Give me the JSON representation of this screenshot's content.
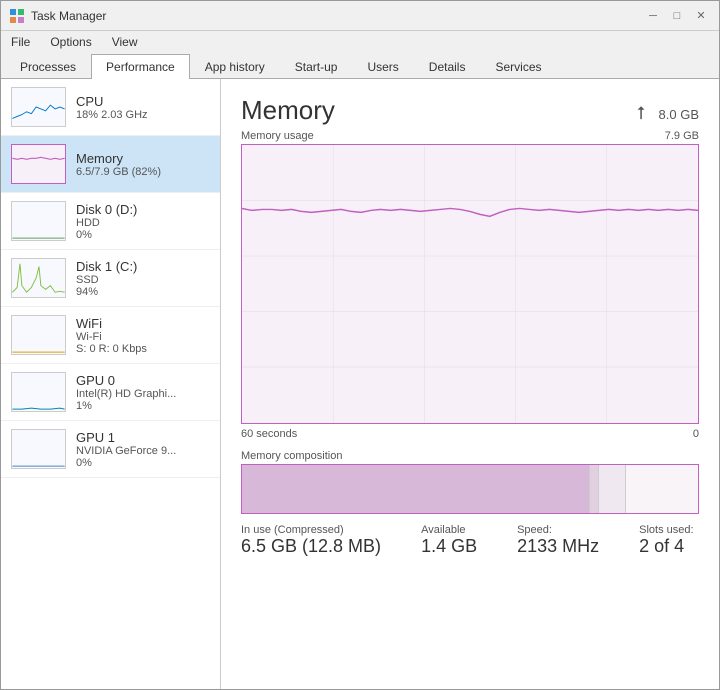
{
  "window": {
    "title": "Task Manager",
    "controls": [
      "─",
      "□",
      "✕"
    ]
  },
  "menu": {
    "items": [
      "File",
      "Options",
      "View"
    ]
  },
  "tabs": [
    {
      "label": "Processes",
      "active": false
    },
    {
      "label": "Performance",
      "active": true
    },
    {
      "label": "App history",
      "active": false
    },
    {
      "label": "Start-up",
      "active": false
    },
    {
      "label": "Users",
      "active": false
    },
    {
      "label": "Details",
      "active": false
    },
    {
      "label": "Services",
      "active": false
    }
  ],
  "sidebar": {
    "items": [
      {
        "id": "cpu",
        "title": "CPU",
        "subtitle": "18% 2.03 GHz",
        "value": "",
        "active": false,
        "color": "#0078d4"
      },
      {
        "id": "memory",
        "title": "Memory",
        "subtitle": "6.5/7.9 GB (82%)",
        "value": "",
        "active": true,
        "color": "#c060c0"
      },
      {
        "id": "disk0",
        "title": "Disk 0 (D:)",
        "subtitle": "HDD",
        "value": "0%",
        "active": false,
        "color": "#60a060"
      },
      {
        "id": "disk1",
        "title": "Disk 1 (C:)",
        "subtitle": "SSD",
        "value": "94%",
        "active": false,
        "color": "#80c040"
      },
      {
        "id": "wifi",
        "title": "WiFi",
        "subtitle": "Wi-Fi",
        "value": "S: 0  R: 0 Kbps",
        "active": false,
        "color": "#e0a000"
      },
      {
        "id": "gpu0",
        "title": "GPU 0",
        "subtitle": "Intel(R) HD Graphi...",
        "value": "1%",
        "active": false,
        "color": "#0088aa"
      },
      {
        "id": "gpu1",
        "title": "GPU 1",
        "subtitle": "NVIDIA GeForce 9...",
        "value": "0%",
        "active": false,
        "color": "#4488bb"
      }
    ]
  },
  "main": {
    "title": "Memory",
    "total": "8.0 GB",
    "chart_title": "Memory usage",
    "chart_max": "7.9 GB",
    "time_left": "60 seconds",
    "time_right": "0",
    "comp_label": "Memory composition",
    "stats": [
      {
        "label": "In use (Compressed)",
        "value": "6.5 GB (12.8 MB)"
      },
      {
        "label": "Available",
        "value": "1.4 GB"
      },
      {
        "label": "Speed:",
        "value": "2133 MHz"
      },
      {
        "label": "Slots used:",
        "value": "2 of 4"
      }
    ]
  }
}
